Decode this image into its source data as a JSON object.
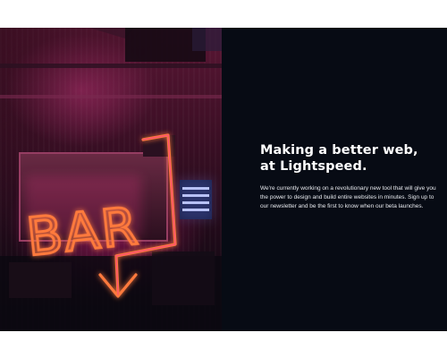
{
  "hero": {
    "sign_text": "BAR"
  },
  "content": {
    "headline_line1": "Making a better web,",
    "headline_line2": "at Lightspeed.",
    "body": "We're currently working on a revolutionary new tool that will give you the power to design and build entire websites in minutes. Sign up to our newsletter and be the first to know when our beta launches."
  },
  "colors": {
    "panel_bg": "#070b14",
    "neon_orange": "#ff7a3c",
    "neon_pink": "#ff3b8e",
    "text": "#ffffff"
  }
}
